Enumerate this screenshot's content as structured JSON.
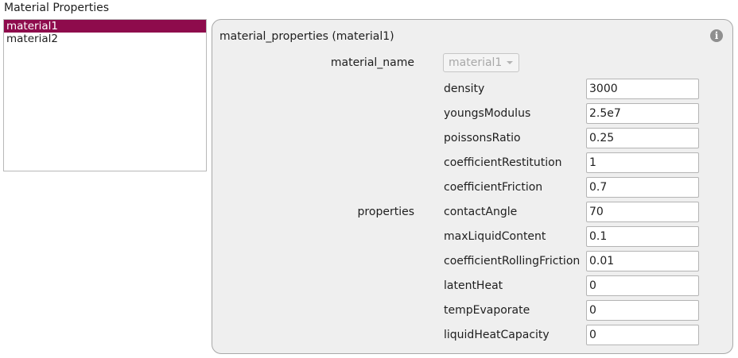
{
  "window": {
    "title": "Material Properties"
  },
  "materials_list": {
    "items": [
      "material1",
      "material2"
    ],
    "selected_index": 0
  },
  "panel": {
    "title": "material_properties (material1)",
    "info_icon": "info-icon",
    "material_name_label": "material_name",
    "material_name_value": "material1",
    "properties_label": "properties",
    "properties": [
      {
        "name": "density",
        "value": "3000"
      },
      {
        "name": "youngsModulus",
        "value": "2.5e7"
      },
      {
        "name": "poissonsRatio",
        "value": "0.25"
      },
      {
        "name": "coefficientRestitution",
        "value": "1"
      },
      {
        "name": "coefficientFriction",
        "value": "0.7"
      },
      {
        "name": "contactAngle",
        "value": "70"
      },
      {
        "name": "maxLiquidContent",
        "value": "0.1"
      },
      {
        "name": "coefficientRollingFriction",
        "value": "0.01"
      },
      {
        "name": "latentHeat",
        "value": "0"
      },
      {
        "name": "tempEvaporate",
        "value": "0"
      },
      {
        "name": "liquidHeatCapacity",
        "value": "0"
      }
    ]
  },
  "colors": {
    "selection": "#8e0b4c",
    "panel_background": "#efefef",
    "info_icon": "#8f8f8f"
  }
}
